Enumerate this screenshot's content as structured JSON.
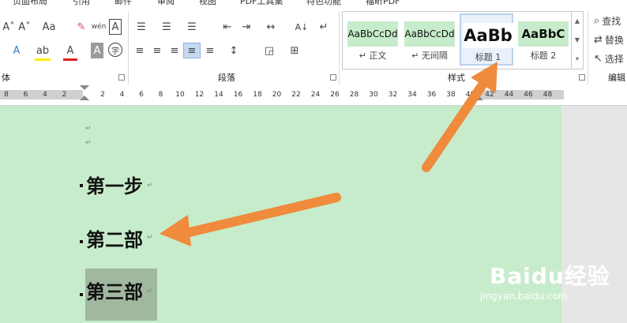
{
  "menu_tabs": [
    "页面布局",
    "引用",
    "邮件",
    "审阅",
    "视图",
    "PDF工具集",
    "特色功能",
    "福昕PDF"
  ],
  "font_group": {
    "label": "体",
    "buttons": [
      {
        "name": "grow-font-button",
        "text": "A˄"
      },
      {
        "name": "shrink-font-button",
        "text": "A˅"
      },
      {
        "name": "change-case-button",
        "text": "Aa"
      },
      {
        "name": "clear-formatting-button",
        "text": "✎"
      },
      {
        "name": "phonetic-guide-button",
        "text": "wén"
      },
      {
        "name": "character-border-button",
        "text": "A"
      },
      {
        "name": "text-effects-button",
        "text": "A"
      },
      {
        "name": "highlight-color-button",
        "text": "ab"
      },
      {
        "name": "font-color-button",
        "text": "A"
      },
      {
        "name": "character-shading-button",
        "text": "A"
      },
      {
        "name": "enclose-characters-button",
        "text": "字"
      }
    ]
  },
  "paragraph_group": {
    "label": "段落",
    "buttons": [
      {
        "name": "bullets-button",
        "text": "☰"
      },
      {
        "name": "numbering-button",
        "text": "☰"
      },
      {
        "name": "multilevel-list-button",
        "text": "☰"
      },
      {
        "name": "decrease-indent-button",
        "text": "⇤"
      },
      {
        "name": "increase-indent-button",
        "text": "⇥"
      },
      {
        "name": "chinese-layout-button",
        "text": "↔"
      },
      {
        "name": "sort-button",
        "text": "A↓"
      },
      {
        "name": "show-marks-button",
        "text": "↵"
      },
      {
        "name": "align-left-button",
        "text": "≡"
      },
      {
        "name": "center-button",
        "text": "≡"
      },
      {
        "name": "align-right-button",
        "text": "≡"
      },
      {
        "name": "justify-button",
        "text": "≡"
      },
      {
        "name": "distributed-button",
        "text": "≡"
      },
      {
        "name": "line-spacing-button",
        "text": "↕"
      },
      {
        "name": "shading-button",
        "text": "◲"
      },
      {
        "name": "borders-button",
        "text": "⊞"
      }
    ]
  },
  "styles_group": {
    "label": "样式",
    "items": [
      {
        "preview": "AaBbCcDd",
        "name": "↵ 正文"
      },
      {
        "preview": "AaBbCcDd",
        "name": "↵ 无间隔"
      },
      {
        "preview": "AaBb",
        "name": "标题 1"
      },
      {
        "preview": "AaBbC",
        "name": "标题 2"
      }
    ]
  },
  "editing_group": {
    "label": "编辑",
    "items": [
      {
        "icon": "⌕",
        "text": "查找"
      },
      {
        "icon": "⇄",
        "text": "替换"
      },
      {
        "icon": "↖",
        "text": "选择"
      }
    ]
  },
  "ruler": {
    "ticks": [
      "8",
      "6",
      "4",
      "2",
      "2",
      "4",
      "6",
      "8",
      "10",
      "12",
      "14",
      "16",
      "18",
      "20",
      "22",
      "24",
      "26",
      "28",
      "30",
      "32",
      "34",
      "36",
      "38",
      "40",
      "42",
      "44",
      "46",
      "48"
    ]
  },
  "document": {
    "paragraph_mark": "↵",
    "headings": [
      "第一步",
      "第二部",
      "第三部"
    ]
  },
  "watermark": {
    "logo": "Baidu经验",
    "url": "jingyan.baidu.com"
  },
  "colors": {
    "page": "#c7eccb",
    "arrow": "#f08a3c",
    "selection": "#a0b8a0"
  }
}
